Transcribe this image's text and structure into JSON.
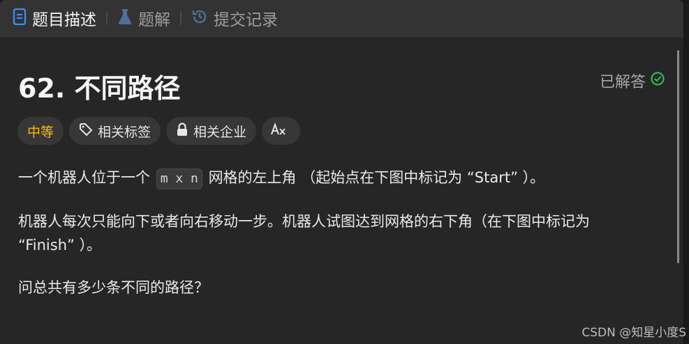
{
  "tabs": {
    "description": "题目描述",
    "solutions": "题解",
    "submissions": "提交记录"
  },
  "problem": {
    "title": "62. 不同路径",
    "status": "已解答",
    "difficulty": "中等",
    "tags_label": "相关标签",
    "companies_label": "相关企业",
    "translate_label": "Aあ"
  },
  "description": {
    "p1_before": "一个机器人位于一个",
    "p1_code": "m x n",
    "p1_after": "网格的左上角 （起始点在下图中标记为 “Start” ）。",
    "p2_line1": "机器人每次只能向下或者向右移动一步。机器人试图达到网格的右下角（在下图中标记为",
    "p2_line2": "“Finish” ）。",
    "p3": "问总共有多少条不同的路径？"
  },
  "watermark": "CSDN @知星小度S",
  "colors": {
    "accent_blue": "#3c8cf0",
    "difficulty_medium": "#ffb800",
    "solved_green": "#2cbb5d"
  },
  "icons": [
    "document-icon",
    "flask-icon",
    "history-icon",
    "check-circle-icon",
    "tag-icon",
    "lock-icon",
    "translate-icon"
  ]
}
